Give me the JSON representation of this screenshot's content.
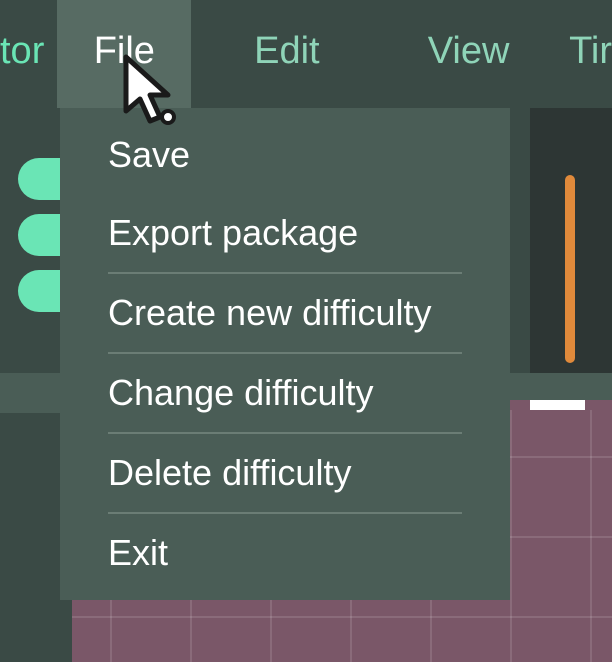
{
  "menubar": {
    "prev_fragment": "tor",
    "items": [
      {
        "label": "File",
        "active": true
      },
      {
        "label": "Edit",
        "active": false
      },
      {
        "label": "View",
        "active": false
      }
    ],
    "next_fragment": "Tir"
  },
  "dropdown": {
    "items": [
      {
        "label": "Save"
      },
      {
        "label": "Export package"
      },
      {
        "label": "Create new difficulty"
      },
      {
        "label": "Change difficulty"
      },
      {
        "label": "Delete difficulty"
      },
      {
        "label": "Exit"
      }
    ]
  },
  "colors": {
    "accent_green": "#6ae5b5",
    "accent_orange": "#e08a3b",
    "accent_purple": "#7a5768",
    "menu_bg": "#4a5d56",
    "menu_active": "#576b63"
  }
}
